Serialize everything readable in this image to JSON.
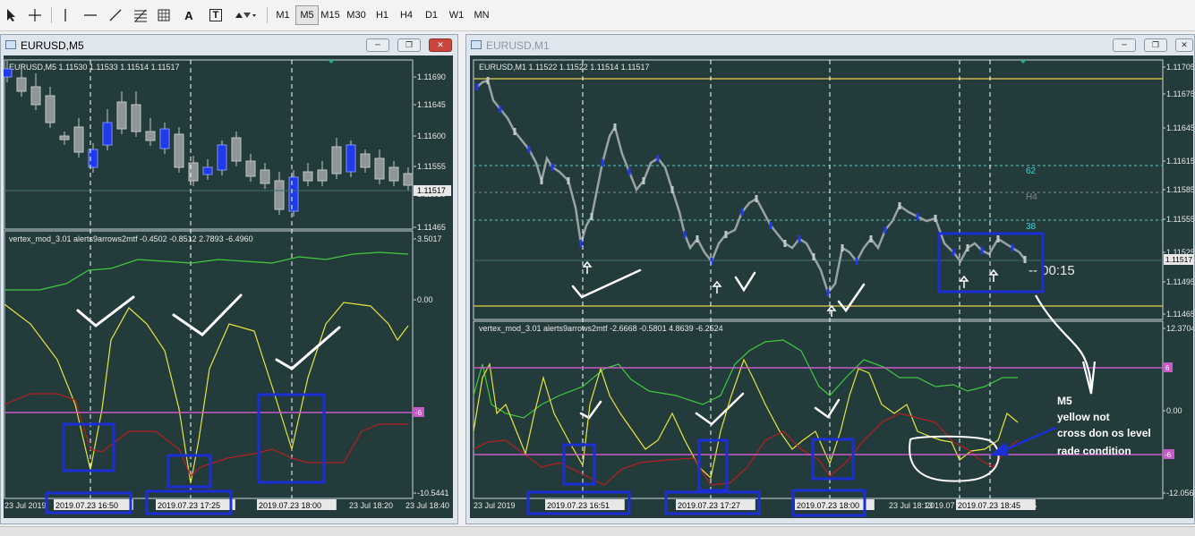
{
  "toolbar": {
    "timeframes": [
      "M1",
      "M5",
      "M15",
      "M30",
      "H1",
      "H4",
      "D1",
      "W1",
      "MN"
    ],
    "active_timeframe": "M5",
    "tools": [
      "cursor-icon",
      "crosshair-icon",
      "vertical-line-icon",
      "horizontal-line-icon",
      "trendline-icon",
      "fibonacci-icon",
      "text-icon",
      "text-label-icon",
      "arrows-icon"
    ],
    "text_tool_label": "A",
    "text_label_tool_label": "T"
  },
  "left": {
    "window_title": "EURUSD,M5",
    "chart_header": "EURUSD,M5  1.11530 1.11533 1.11514 1.11517",
    "price_labels": [
      "1.11690",
      "1.11645",
      "1.11600",
      "1.11555",
      "1.11510",
      "1.11465"
    ],
    "current_price": "1.11517",
    "indicator_header": "vertex_mod_3.01 alerts9arrows2mtf -0.4502 -0.8512 2.7893 -6.4960",
    "indicator_labels": [
      "3.5017",
      "0.00",
      "-10.5441"
    ],
    "level_tag": "-6",
    "time_labels": [
      "23 Jul 2019",
      "2019.07.23 16:50",
      "2019.07.23 17:25",
      "2019.07.23 18:00",
      "23 Jul 18:20",
      "23 Jul 18:40"
    ]
  },
  "right": {
    "window_title": "EURUSD,M1",
    "chart_header": "EURUSD,M1  1.11522 1.11522 1.11514 1.11517",
    "price_labels": [
      "1.11705",
      "1.11675",
      "1.11645",
      "1.11615",
      "1.11585",
      "1.11555",
      "1.11525",
      "1.11495",
      "1.11465"
    ],
    "current_price": "1.11517",
    "fib_labels": [
      "62",
      "H4",
      "38"
    ],
    "countdown": "--  00:15",
    "indicator_header": "vertex_mod_3.01 alerts9arrows2mtf -2.6668 -0.5801 4.8639 -6.2524",
    "indicator_labels": [
      "12.3704",
      "0.00",
      "-12.0561"
    ],
    "level_tags": [
      "6",
      "-6"
    ],
    "time_labels": [
      "23 Jul 2019",
      "2019.07.23 16:51",
      "2019.07.23 17:27",
      "2019.07.23 18:00",
      "23 Jul 18:13",
      "2019.07",
      "2019.07.23 18:45",
      "45"
    ],
    "annotation": [
      "M5",
      "yellow not",
      "cross don os level",
      "rade condition"
    ]
  },
  "colors": {
    "chart_bg": "#243b3c",
    "grid": "#4d6b6c",
    "yellow": "#e6e63a",
    "green": "#3fca3f",
    "red": "#b42020",
    "magenta": "#c85ac8",
    "blue_box": "#1b2fd6",
    "cyan_level": "#3ad6d6"
  }
}
